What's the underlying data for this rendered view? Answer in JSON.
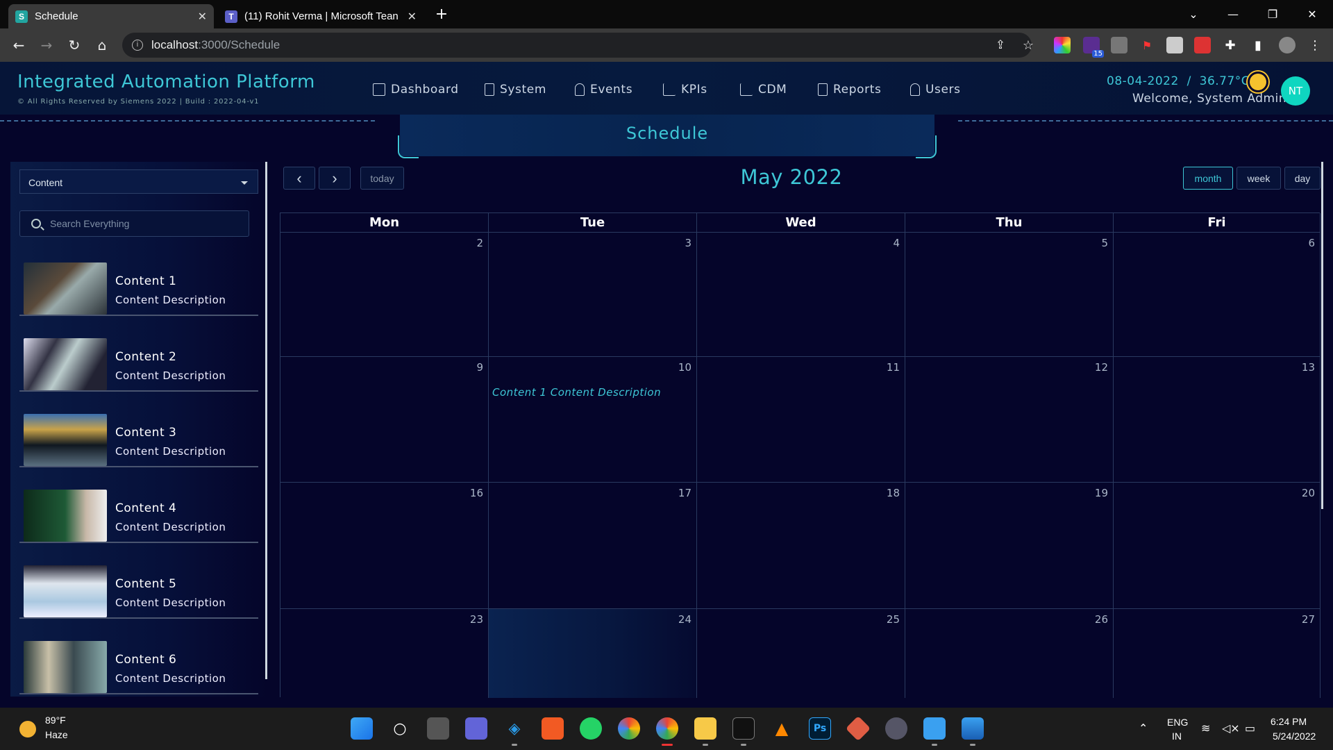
{
  "browser": {
    "tabs": [
      {
        "title": "Schedule",
        "favicon": "S",
        "active": true
      },
      {
        "title": "(11) Rohit Verma | Microsoft Tean",
        "favicon": "T",
        "active": false
      }
    ],
    "url_host": "localhost",
    "url_path": ":3000/Schedule",
    "extension_badge": "15"
  },
  "app": {
    "title": "Integrated Automation Platform",
    "subtitle": "© All Rights Reserved by Siemens 2022 | Build : 2022-04-v1",
    "nav": [
      {
        "label": "Dashboard",
        "icon": "dashboard-icon"
      },
      {
        "label": "System",
        "icon": "building-icon"
      },
      {
        "label": "Events",
        "icon": "bell-icon"
      },
      {
        "label": "KPIs",
        "icon": "chart-icon"
      },
      {
        "label": "CDM",
        "icon": "chart-icon"
      },
      {
        "label": "Reports",
        "icon": "report-icon"
      },
      {
        "label": "Users",
        "icon": "user-icon"
      }
    ],
    "date_temp": "08-04-2022  /  36.77°C",
    "welcome": "Welcome, System Admin",
    "avatar_initials": "NT",
    "accent_color": "#3ec7d6"
  },
  "page": {
    "title": "Schedule"
  },
  "sidebar": {
    "category_select": "Content",
    "search_placeholder": "Search Everything",
    "items": [
      {
        "name": "Content 1",
        "description": "Content Description"
      },
      {
        "name": "Content 2",
        "description": "Content Description"
      },
      {
        "name": "Content 3",
        "description": "Content Description"
      },
      {
        "name": "Content 4",
        "description": "Content Description"
      },
      {
        "name": "Content 5",
        "description": "Content Description"
      },
      {
        "name": "Content 6",
        "description": "Content Description"
      }
    ]
  },
  "calendar": {
    "title": "May 2022",
    "prev_label": "‹",
    "next_label": "›",
    "today_label": "today",
    "views": [
      "month",
      "week",
      "day"
    ],
    "active_view": "month",
    "weekdays": [
      "Mon",
      "Tue",
      "Wed",
      "Thu",
      "Fri"
    ],
    "weeks": [
      [
        "2",
        "3",
        "4",
        "5",
        "6"
      ],
      [
        "9",
        "10",
        "11",
        "12",
        "13"
      ],
      [
        "16",
        "17",
        "18",
        "19",
        "20"
      ],
      [
        "23",
        "24",
        "25",
        "26",
        "27"
      ]
    ],
    "event": {
      "text": "Content 1 Content Description",
      "day": "10"
    },
    "today_day": "24"
  },
  "taskbar": {
    "weather_temp": "89°F",
    "weather_desc": "Haze",
    "lang_top": "ENG",
    "lang_bottom": "IN",
    "time": "6:24 PM",
    "date": "5/24/2022"
  }
}
